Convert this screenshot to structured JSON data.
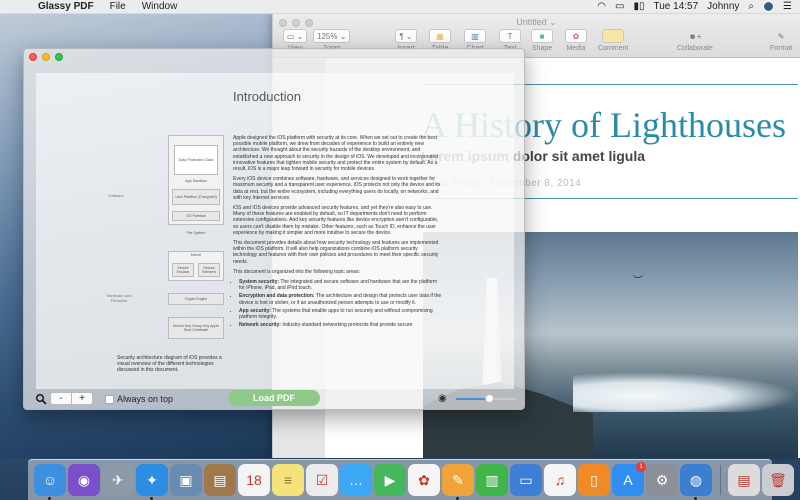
{
  "menubar": {
    "app_name": "Glassy PDF",
    "menus": [
      "File",
      "Window"
    ],
    "clock": "Tue 14:57",
    "user": "Johnny"
  },
  "pages": {
    "doc_title": "Untitled",
    "toolbar": {
      "view": "View",
      "zoom_value": "125%",
      "zoom": "Zoom",
      "insert": "Insert",
      "table": "Table",
      "chart": "Chart",
      "text": "Text",
      "shape": "Shape",
      "media": "Media",
      "comment": "Comment",
      "collaborate": "Collaborate",
      "format": "Format"
    },
    "heading": "A History of Lighthouses",
    "subheading": "Lorem ipsum dolor sit amet ligula",
    "byline": "Tranz Pruca - December 8, 2014"
  },
  "glassy": {
    "intro_title": "Introduction",
    "paragraphs": [
      "Apple designed the iOS platform with security at its core. When we set out to create the best possible mobile platform, we drew from decades of experience to build an entirely new architecture. We thought about the security hazards of the desktop environment, and established a new approach to security in the design of iOS. We developed and incorporated innovative features that tighten mobile security and protect the entire system by default. As a result, iOS is a major leap forward in security for mobile devices.",
      "Every iOS device combines software, hardware, and services designed to work together for maximum security and a transparent user experience. iOS protects not only the device and its data at rest, but the entire ecosystem, including everything users do locally, on networks, and with key Internet services.",
      "iOS and iOS devices provide advanced security features, and yet they're also easy to use. Many of these features are enabled by default, so IT departments don't need to perform extensive configurations. And key security features like device encryption aren't configurable, so users can't disable them by mistake. Other features, such as Touch ID, enhance the user experience by making it simpler and more intuitive to secure the device.",
      "This document provides details about how security technology and features are implemented within the iOS platform. It will also help organizations combine iOS platform security technology and features with their own policies and procedures to meet their specific security needs.",
      "This document is organized into the following topic areas:"
    ],
    "topics": [
      {
        "term": "System security:",
        "text": " The integrated and secure software and hardware that are the platform for iPhone, iPad, and iPod touch."
      },
      {
        "term": "Encryption and data protection:",
        "text": " The architecture and design that protects user data if the device is lost or stolen, or if an unauthorized person attempts to use or modify it."
      },
      {
        "term": "App security:",
        "text": " The systems that enable apps to run securely and without compromising platform integrity."
      },
      {
        "term": "Network security:",
        "text": " Industry-standard networking protocols that provide secure"
      }
    ],
    "diagram": {
      "software_label": "Software",
      "hardware_label": "Hardware and Firmware",
      "data_protection": "Data Protection Class",
      "app_sandbox": "App Sandbox",
      "user_partition": "User Partition (Encrypted)",
      "os_partition": "OS Partition",
      "file_system": "File System",
      "kernel": "Kernel",
      "secure_enclave": "Secure Enclave",
      "secure_element": "Secure Element",
      "crypto_engine": "Crypto Engine",
      "device_key": "Device Key Group Key Apple Root Certificate"
    },
    "diagram_caption": "Security architecture diagram of iOS provides a visual overview of the different technologies discussed in this document.",
    "zoom_minus": "-",
    "zoom_plus": "+",
    "always_on_top": "Always on top",
    "load_pdf": "Load PDF",
    "opacity": 0.55
  },
  "dock": {
    "apps": [
      {
        "name": "finder",
        "color": "#3d8fe0",
        "glyph": "☺",
        "running": true
      },
      {
        "name": "siri",
        "color": "#7a4fc9",
        "glyph": "◉",
        "running": false
      },
      {
        "name": "launchpad",
        "color": "#8d9aa8",
        "glyph": "✈",
        "running": false
      },
      {
        "name": "safari",
        "color": "#2d8de3",
        "glyph": "✦",
        "running": true
      },
      {
        "name": "preview",
        "color": "#6a8cb0",
        "glyph": "▣",
        "running": false
      },
      {
        "name": "notebook",
        "color": "#a0784a",
        "glyph": "▤",
        "running": false
      },
      {
        "name": "calendar",
        "color": "#f4f4f4",
        "glyph": "18",
        "running": false
      },
      {
        "name": "notes",
        "color": "#f6e27a",
        "glyph": "≡",
        "running": false
      },
      {
        "name": "reminders",
        "color": "#ececec",
        "glyph": "☑",
        "running": false
      },
      {
        "name": "messages",
        "color": "#3ba7f5",
        "glyph": "…",
        "running": false
      },
      {
        "name": "facetime",
        "color": "#44b85a",
        "glyph": "▶",
        "running": false
      },
      {
        "name": "photos",
        "color": "#f5f5f5",
        "glyph": "✿",
        "running": false
      },
      {
        "name": "pages",
        "color": "#f0a33a",
        "glyph": "✎",
        "running": true
      },
      {
        "name": "numbers",
        "color": "#3fb54a",
        "glyph": "▥",
        "running": false
      },
      {
        "name": "keynote",
        "color": "#3e7fd6",
        "glyph": "▭",
        "running": false
      },
      {
        "name": "itunes",
        "color": "#f5f5f5",
        "glyph": "♫",
        "running": false
      },
      {
        "name": "ibooks",
        "color": "#f08a24",
        "glyph": "▯",
        "running": false
      },
      {
        "name": "app-store",
        "color": "#2f8ef0",
        "glyph": "A",
        "running": false,
        "badge": "1"
      },
      {
        "name": "system-preferences",
        "color": "#8b8f96",
        "glyph": "⚙",
        "running": false
      },
      {
        "name": "glassy-pdf",
        "color": "#3c7fd0",
        "glyph": "◍",
        "running": true
      }
    ],
    "stack": {
      "name": "downloads-stack",
      "color": "#dcdcdc",
      "glyph": "▤"
    },
    "trash": {
      "name": "trash",
      "color": "#c9cdd2",
      "glyph": "🗑"
    }
  }
}
